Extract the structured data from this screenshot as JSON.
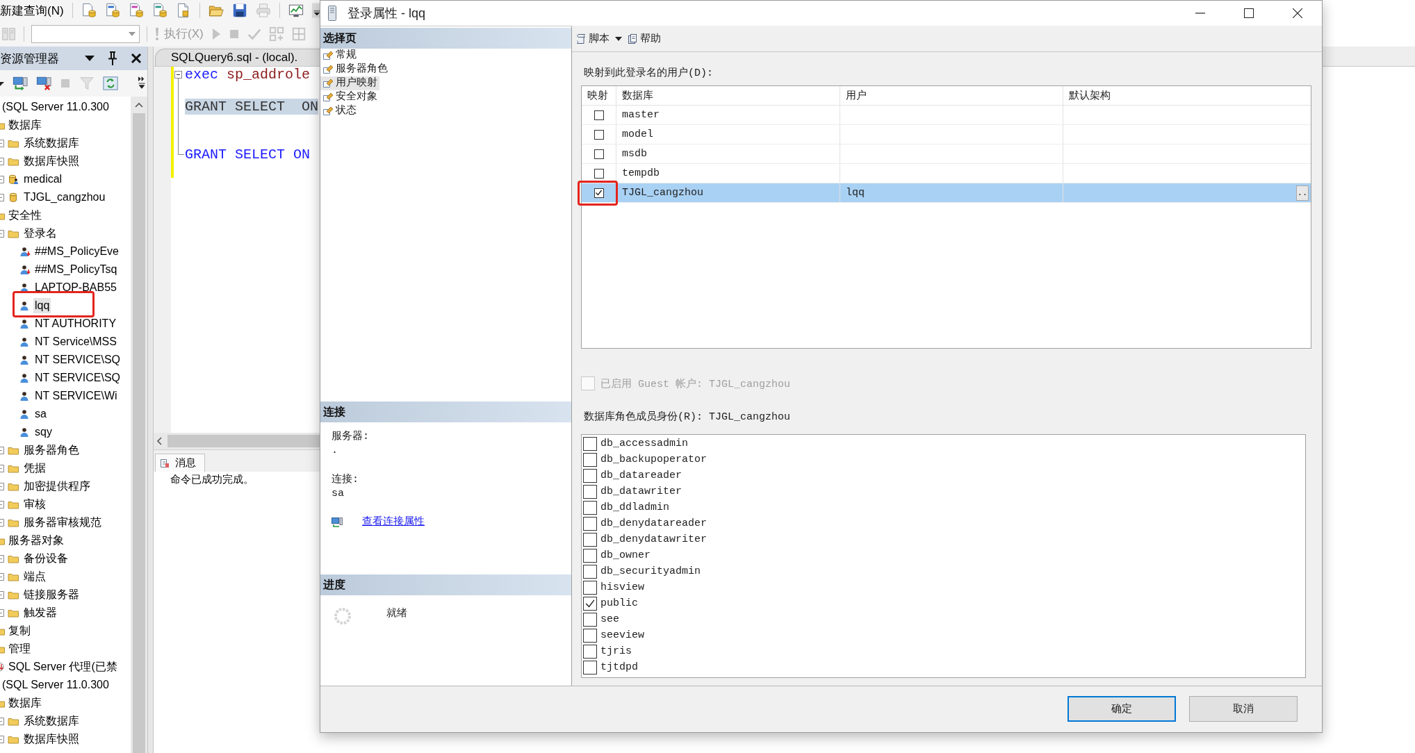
{
  "toolbar": {
    "new_query": "新建查询(N)",
    "execute": {
      "label": "执行(X)",
      "disabled": true
    }
  },
  "object_explorer": {
    "title": "资源管理器",
    "tree": [
      {
        "label": "(SQL Server 11.0.300",
        "selected": false,
        "children": [
          {
            "label": "数据库",
            "kind": "folder",
            "selected": false,
            "children": [
              {
                "label": "系统数据库",
                "kind": "folder",
                "selected": false
              },
              {
                "label": "数据库快照",
                "kind": "folder",
                "selected": false
              },
              {
                "label": "medical",
                "kind": "database-user",
                "selected": false
              },
              {
                "label": "TJGL_cangzhou",
                "kind": "database",
                "selected": false
              }
            ]
          },
          {
            "label": "安全性",
            "kind": "folder",
            "selected": false,
            "children": [
              {
                "label": "登录名",
                "kind": "folder",
                "selected": false,
                "children": [
                  {
                    "label": "##MS_PolicyEve",
                    "kind": "login",
                    "disabled": true,
                    "selected": false,
                    "marked": false
                  },
                  {
                    "label": "##MS_PolicyTsq",
                    "kind": "login",
                    "disabled": true,
                    "selected": false,
                    "marked": false
                  },
                  {
                    "label": "LAPTOP-BAB55",
                    "kind": "login",
                    "disabled": false,
                    "selected": false,
                    "marked": false
                  },
                  {
                    "label": "lqq",
                    "kind": "login",
                    "disabled": false,
                    "selected": true,
                    "marked": true
                  },
                  {
                    "label": "NT AUTHORITY",
                    "kind": "login",
                    "disabled": false,
                    "selected": false,
                    "marked": false
                  },
                  {
                    "label": "NT Service\\MSS",
                    "kind": "login",
                    "disabled": false,
                    "selected": false,
                    "marked": false
                  },
                  {
                    "label": "NT SERVICE\\SQ",
                    "kind": "login",
                    "disabled": false,
                    "selected": false,
                    "marked": false
                  },
                  {
                    "label": "NT SERVICE\\SQ",
                    "kind": "login",
                    "disabled": false,
                    "selected": false,
                    "marked": false
                  },
                  {
                    "label": "NT SERVICE\\Wi",
                    "kind": "login",
                    "disabled": false,
                    "selected": false,
                    "marked": false
                  },
                  {
                    "label": "sa",
                    "kind": "login",
                    "disabled": false,
                    "selected": false,
                    "marked": false
                  },
                  {
                    "label": "sqy",
                    "kind": "login",
                    "disabled": false,
                    "selected": false,
                    "marked": false
                  }
                ]
              },
              {
                "label": "服务器角色",
                "kind": "folder",
                "selected": false
              },
              {
                "label": "凭据",
                "kind": "folder",
                "selected": false
              },
              {
                "label": "加密提供程序",
                "kind": "folder",
                "selected": false
              },
              {
                "label": "审核",
                "kind": "folder",
                "selected": false
              },
              {
                "label": "服务器审核规范",
                "kind": "folder",
                "selected": false
              }
            ]
          },
          {
            "label": "服务器对象",
            "kind": "folder",
            "selected": false,
            "children": [
              {
                "label": "备份设备",
                "kind": "folder",
                "selected": false
              },
              {
                "label": "端点",
                "kind": "folder",
                "selected": false
              },
              {
                "label": "链接服务器",
                "kind": "folder",
                "selected": false
              },
              {
                "label": "触发器",
                "kind": "folder",
                "selected": false
              }
            ]
          },
          {
            "label": "复制",
            "kind": "folder",
            "selected": false
          },
          {
            "label": "管理",
            "kind": "folder",
            "selected": false
          },
          {
            "label": "SQL Server 代理(已禁",
            "kind": "agent",
            "selected": false
          }
        ]
      },
      {
        "label": "(SQL Server 11.0.300",
        "selected": false,
        "children": [
          {
            "label": "数据库",
            "kind": "folder",
            "selected": false,
            "children": [
              {
                "label": "系统数据库",
                "kind": "folder",
                "selected": false
              },
              {
                "label": "数据库快照",
                "kind": "folder",
                "selected": false
              }
            ]
          }
        ]
      }
    ]
  },
  "editor": {
    "tab": "SQLQuery6.sql - (local).",
    "lines": [
      {
        "kind": "code",
        "selected": false,
        "tokens": [
          {
            "kind": "keyword",
            "text": "exec"
          },
          {
            "kind": "procedure",
            "text": "sp_addrole"
          }
        ]
      },
      {
        "kind": "blank"
      },
      {
        "kind": "code",
        "selected": true,
        "tokens": [
          {
            "kind": "plain",
            "text": "GRANT SELECT  ON"
          }
        ]
      },
      {
        "kind": "blank"
      },
      {
        "kind": "blank"
      },
      {
        "kind": "code",
        "selected": false,
        "tokens": [
          {
            "kind": "keyword",
            "text": "GRANT SELECT ON"
          }
        ]
      }
    ]
  },
  "messages": {
    "tab": "消息",
    "text": "命令已成功完成。"
  },
  "dialog": {
    "title": "登录属性 - lqq",
    "select_page": {
      "heading": "选择页",
      "pages": [
        {
          "label": "常规",
          "selected": false
        },
        {
          "label": "服务器角色",
          "selected": false
        },
        {
          "label": "用户映射",
          "selected": true
        },
        {
          "label": "安全对象",
          "selected": false
        },
        {
          "label": "状态",
          "selected": false
        }
      ]
    },
    "connection": {
      "heading": "连接",
      "server_label": "服务器:",
      "server": ".",
      "connection_label": "连接:",
      "connection": "sa",
      "link": "查看连接属性"
    },
    "progress": {
      "heading": "进度",
      "status": "就绪"
    },
    "toolbar": {
      "script": "脚本",
      "help": "帮助"
    },
    "mapping": {
      "label": "映射到此登录名的用户(D):",
      "columns": [
        "映射",
        "数据库",
        "用户",
        "默认架构"
      ],
      "rows": [
        {
          "mapped": false,
          "database": "master",
          "selected": false,
          "marked": false
        },
        {
          "mapped": false,
          "database": "model",
          "selected": false,
          "marked": false
        },
        {
          "mapped": false,
          "database": "msdb",
          "selected": false,
          "marked": false
        },
        {
          "mapped": false,
          "database": "tempdb",
          "selected": false,
          "marked": false
        },
        {
          "mapped": true,
          "database": "TJGL_cangzhou",
          "user": "lqq",
          "schema_button": "..",
          "selected": true,
          "marked": true
        }
      ]
    },
    "guest": {
      "label": "已启用 Guest 帐户: TJGL_cangzhou",
      "checked": false,
      "disabled": true
    },
    "roles": {
      "label": "数据库角色成员身份(R): TJGL_cangzhou",
      "items": [
        {
          "name": "db_accessadmin",
          "checked": false
        },
        {
          "name": "db_backupoperator",
          "checked": false
        },
        {
          "name": "db_datareader",
          "checked": false
        },
        {
          "name": "db_datawriter",
          "checked": false
        },
        {
          "name": "db_ddladmin",
          "checked": false
        },
        {
          "name": "db_denydatareader",
          "checked": false
        },
        {
          "name": "db_denydatawriter",
          "checked": false
        },
        {
          "name": "db_owner",
          "checked": false
        },
        {
          "name": "db_securityadmin",
          "checked": false
        },
        {
          "name": "hisview",
          "checked": false
        },
        {
          "name": "public",
          "checked": true
        },
        {
          "name": "see",
          "checked": false
        },
        {
          "name": "seeview",
          "checked": false
        },
        {
          "name": "tjris",
          "checked": false
        },
        {
          "name": "tjtdpd",
          "checked": false
        }
      ]
    },
    "buttons": [
      {
        "label": "确定",
        "default": true
      },
      {
        "label": "取消",
        "default": false
      }
    ]
  }
}
